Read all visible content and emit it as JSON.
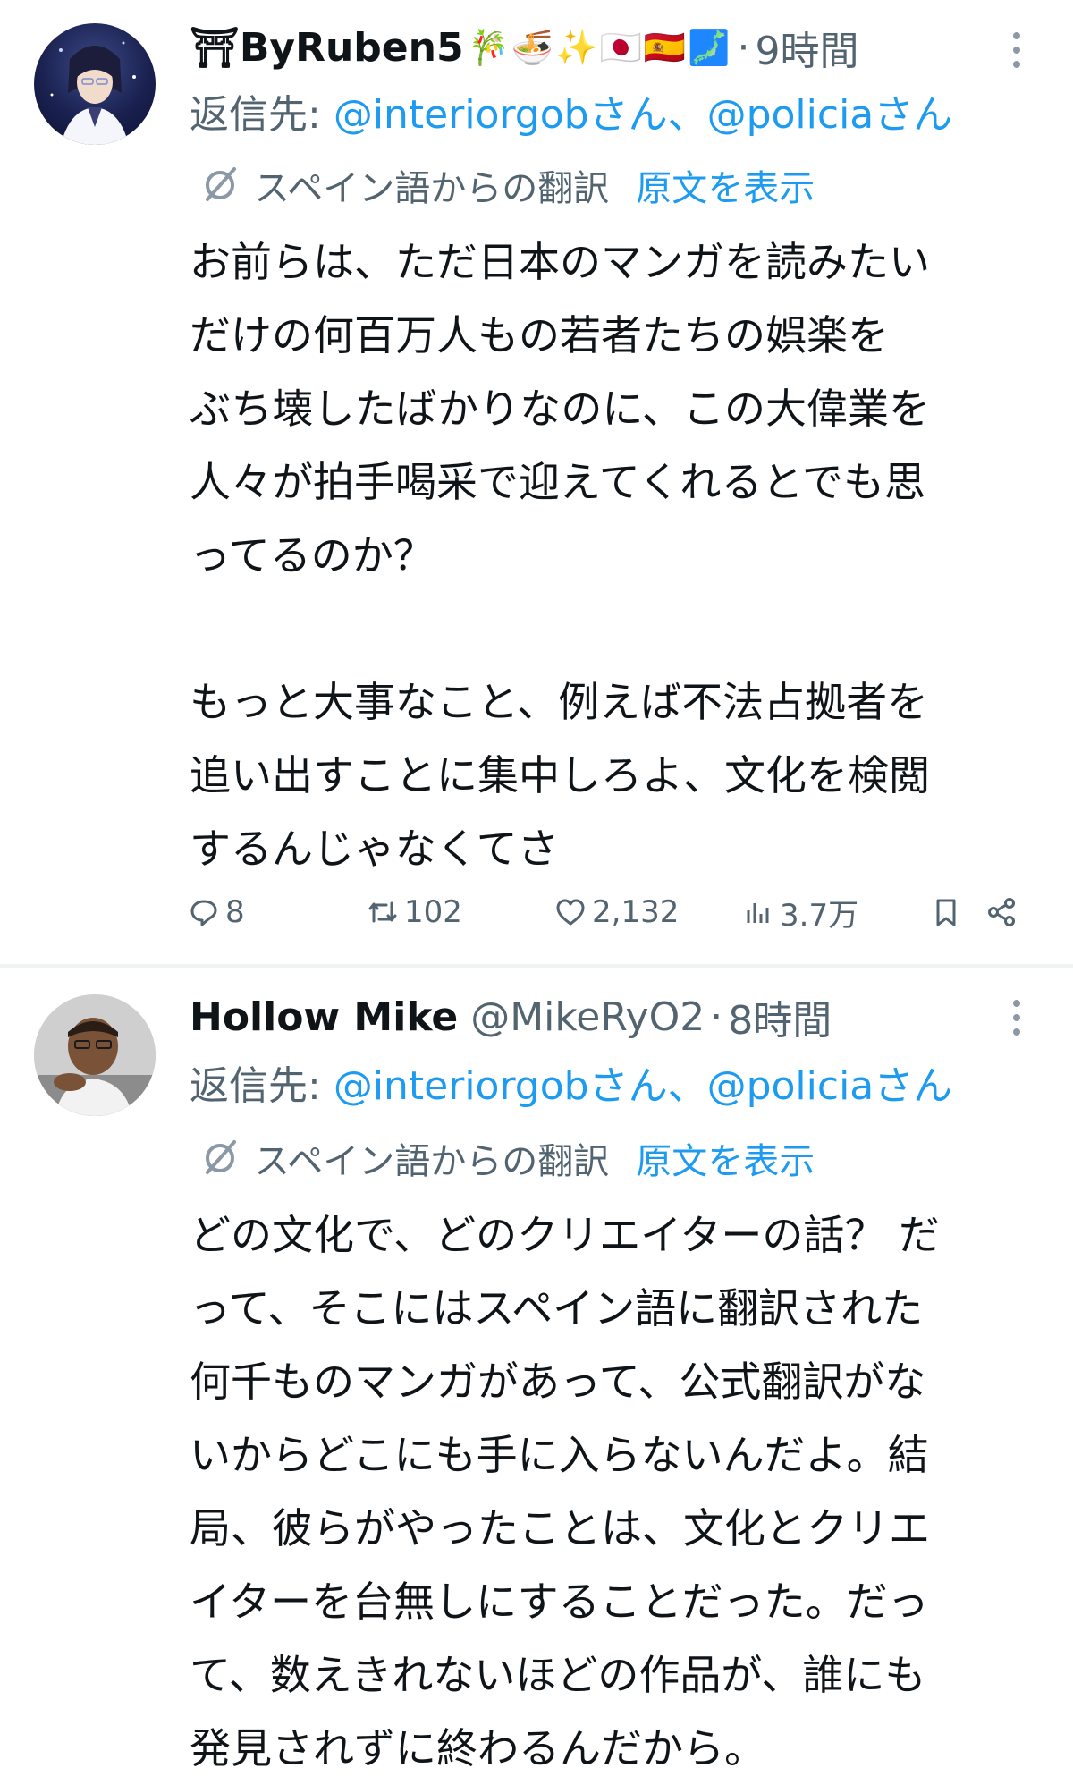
{
  "tweets": [
    {
      "display_name": "⛩ByRuben5",
      "name_emojis": "🎋🍜✨🇯🇵🇪🇸🗾",
      "handle": "",
      "dot": "·",
      "time": "9時間",
      "reply_prefix": "返信先: ",
      "reply_mention_1": "@interiorgobさん",
      "reply_separator": "、",
      "reply_mention_2": "@policiaさん",
      "translation_label": "スペイン語からの翻訳",
      "show_original": "原文を表示",
      "body": "お前らは、ただ日本のマンガを読みたい\nだけの何百万人もの若者たちの娯楽を\nぶち壊したばかりなのに、この大偉業を\n人々が拍手喝采で迎えてくれるとでも思\nってるのか？\n\nもっと大事なこと、例えば不法占拠者を\n追い出すことに集中しろよ、文化を検閲\nするんじゃなくてさ",
      "stats": {
        "replies": "8",
        "retweets": "102",
        "likes": "2,132",
        "views": "3.7万"
      }
    },
    {
      "display_name": "Hollow Mike",
      "name_emojis": "",
      "handle": "@MikeRyO2",
      "dot": "·",
      "time": "8時間",
      "reply_prefix": "返信先: ",
      "reply_mention_1": "@interiorgobさん",
      "reply_separator": "、",
      "reply_mention_2": "@policiaさん",
      "translation_label": "スペイン語からの翻訳",
      "show_original": "原文を表示",
      "body": "どの文化で、どのクリエイターの話？ だ\nって、そこにはスペイン語に翻訳された\n何千ものマンガがあって、公式翻訳がな\nいからどこにも手に入らないんだよ。結\n局、彼らがやったことは、文化とクリエ\nイターを台無しにすることだった。だっ\nて、数えきれないほどの作品が、誰にも\n発見されずに終わるんだから。"
    }
  ],
  "colors": {
    "link": "#1d9bf0",
    "secondary_text": "#536471",
    "primary_text": "#0f1419",
    "divider": "#eff3f4"
  },
  "icons": {
    "reply": "speech-bubble-icon",
    "retweet": "retweet-arrows-icon",
    "like": "heart-icon",
    "views": "bar-chart-icon",
    "bookmark": "bookmark-icon",
    "share": "share-icon",
    "translate": "translate-icon",
    "more": "more-options-icon"
  }
}
